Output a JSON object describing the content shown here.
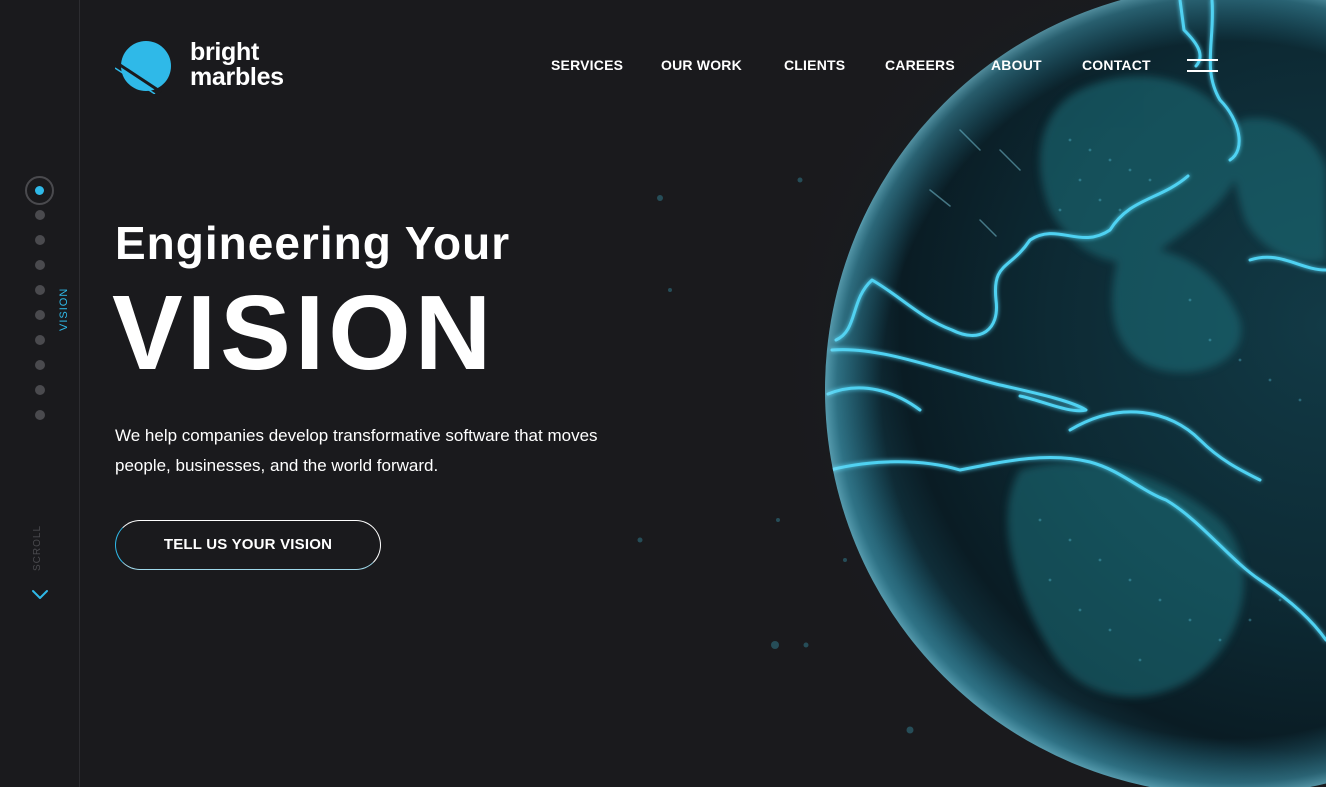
{
  "brand": {
    "name_line1": "bright",
    "name_line2": "marbles",
    "logo_icon": "marble-logo-icon",
    "accent_color": "#2fb9e8",
    "background_color": "#1a1a1d"
  },
  "nav": {
    "items": [
      {
        "label": "SERVICES"
      },
      {
        "label": "OUR WORK"
      },
      {
        "label": "CLIENTS"
      },
      {
        "label": "CAREERS"
      },
      {
        "label": "ABOUT"
      },
      {
        "label": "CONTACT"
      }
    ],
    "menu_icon": "hamburger-menu-icon"
  },
  "rail": {
    "current_section": "VISION",
    "scroll_label": "SCROLL",
    "scroll_icon": "chevron-down-icon",
    "section_count": 10,
    "active_section_index": 0
  },
  "hero": {
    "eyebrow": "Engineering Your",
    "title": "VISION",
    "description": "We help companies develop transformative software that moves people, businesses, and the world forward.",
    "cta_label": "TELL US YOUR VISION",
    "background_visual": "globe-image"
  }
}
